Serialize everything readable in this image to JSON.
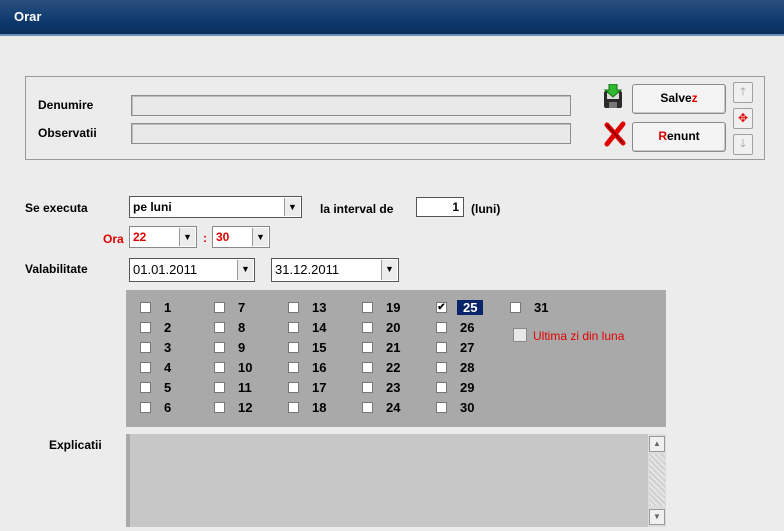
{
  "window": {
    "title": "Orar"
  },
  "form": {
    "denumire_label": "Denumire",
    "denumire_value": "",
    "observatii_label": "Observatii",
    "observatii_value": ""
  },
  "actions": {
    "save_label_pre": "Salve",
    "save_label_hot": "z",
    "cancel_label_hot": "R",
    "cancel_label_post": "enunt"
  },
  "schedule": {
    "se_executa_label": "Se executa",
    "se_executa_value": "pe luni",
    "interval_label": "la interval de",
    "interval_value": "1",
    "interval_unit": "(luni)",
    "ora_label": "Ora",
    "hour_value": "22",
    "time_separator": ":",
    "minute_value": "30",
    "valabilitate_label": "Valabilitate",
    "date_from": "01.01.2011",
    "date_to": "31.12.2011"
  },
  "days": [
    {
      "n": "1",
      "checked": false
    },
    {
      "n": "2",
      "checked": false
    },
    {
      "n": "3",
      "checked": false
    },
    {
      "n": "4",
      "checked": false
    },
    {
      "n": "5",
      "checked": false
    },
    {
      "n": "6",
      "checked": false
    },
    {
      "n": "7",
      "checked": false
    },
    {
      "n": "8",
      "checked": false
    },
    {
      "n": "9",
      "checked": false
    },
    {
      "n": "10",
      "checked": false
    },
    {
      "n": "11",
      "checked": false
    },
    {
      "n": "12",
      "checked": false
    },
    {
      "n": "13",
      "checked": false
    },
    {
      "n": "14",
      "checked": false
    },
    {
      "n": "15",
      "checked": false
    },
    {
      "n": "16",
      "checked": false
    },
    {
      "n": "17",
      "checked": false
    },
    {
      "n": "18",
      "checked": false
    },
    {
      "n": "19",
      "checked": false
    },
    {
      "n": "20",
      "checked": false
    },
    {
      "n": "21",
      "checked": false
    },
    {
      "n": "22",
      "checked": false
    },
    {
      "n": "23",
      "checked": false
    },
    {
      "n": "24",
      "checked": false
    },
    {
      "n": "25",
      "checked": true
    },
    {
      "n": "26",
      "checked": false
    },
    {
      "n": "27",
      "checked": false
    },
    {
      "n": "28",
      "checked": false
    },
    {
      "n": "29",
      "checked": false
    },
    {
      "n": "30",
      "checked": false
    },
    {
      "n": "31",
      "checked": false
    }
  ],
  "last_day_label": "Ultima zi din luna",
  "explicatii_label": "Explicatii",
  "colors": {
    "title_bar": "#0e3a6f",
    "accent_red": "#e00000",
    "selection": "#0a246a"
  },
  "icons": [
    "save-disk-icon",
    "cancel-x-icon",
    "arrow-up-icon",
    "arrow-down-icon",
    "navigate-icon"
  ]
}
